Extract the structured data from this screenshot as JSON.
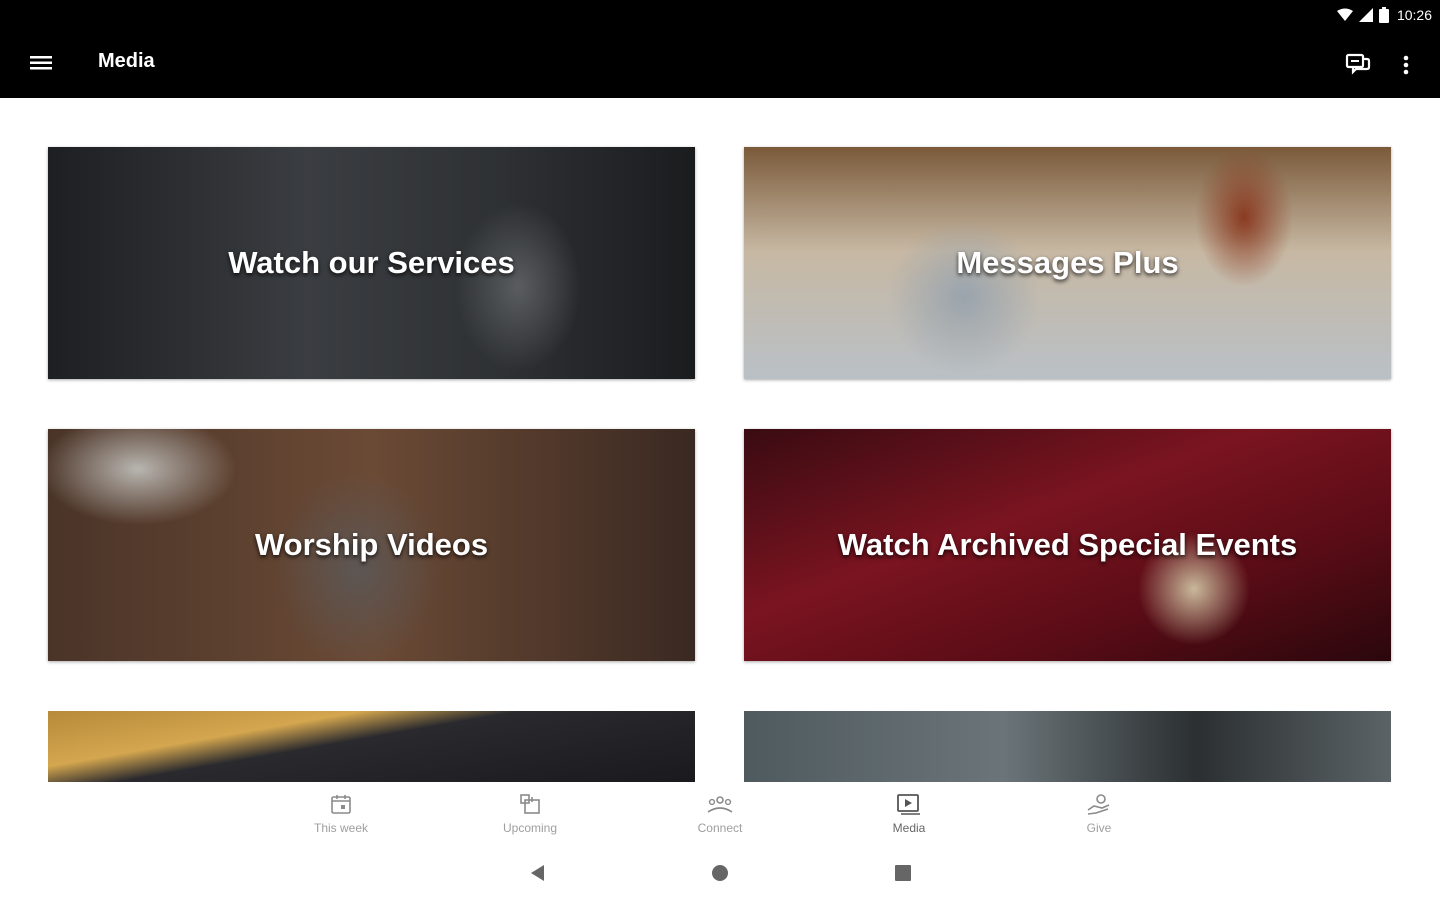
{
  "status_bar": {
    "time": "10:26",
    "icons": [
      "wifi-icon",
      "signal-icon",
      "battery-icon"
    ]
  },
  "app_bar": {
    "title": "Media",
    "menu_icon": "hamburger-menu-icon",
    "chat_icon": "chat-bubbles-icon",
    "more_icon": "more-vertical-icon"
  },
  "tiles": [
    {
      "label": "Watch our Services"
    },
    {
      "label": "Messages Plus"
    },
    {
      "label": "Worship Videos"
    },
    {
      "label": "Watch Archived Special Events"
    },
    {
      "label": ""
    },
    {
      "label": ""
    }
  ],
  "bottom_nav": [
    {
      "label": "This week",
      "icon": "calendar-icon",
      "active": false
    },
    {
      "label": "Upcoming",
      "icon": "upcoming-icon",
      "active": false
    },
    {
      "label": "Connect",
      "icon": "people-icon",
      "active": false
    },
    {
      "label": "Media",
      "icon": "media-icon",
      "active": true
    },
    {
      "label": "Give",
      "icon": "give-icon",
      "active": false
    }
  ],
  "system_nav": [
    "back-icon",
    "home-icon",
    "recents-icon"
  ],
  "colors": {
    "app_bar": "#000000",
    "nav_label": "#9e9e9e",
    "background": "#ffffff"
  }
}
